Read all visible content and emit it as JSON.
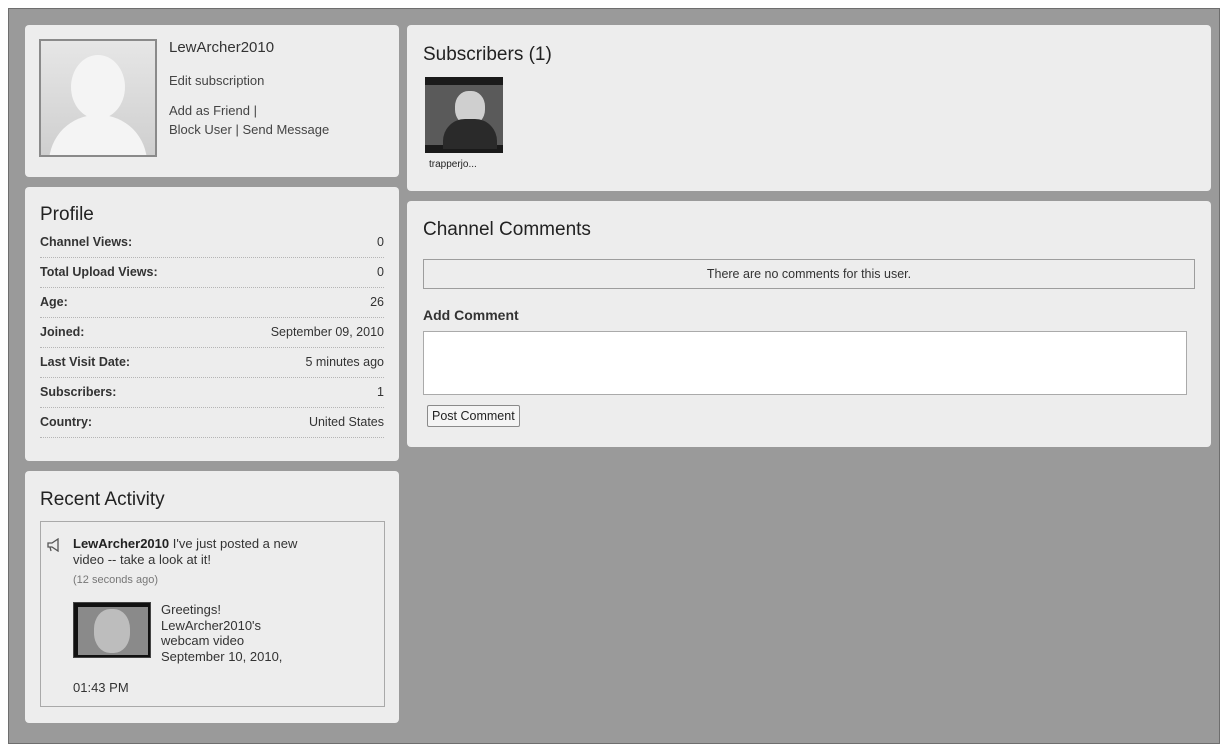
{
  "user": {
    "name": "LewArcher2010",
    "edit_subscription": "Edit subscription",
    "add_friend": "Add as Friend",
    "block_user": "Block User",
    "send_message": "Send Message",
    "separator": "|"
  },
  "profile": {
    "title": "Profile",
    "rows": [
      {
        "label": "Channel Views:",
        "value": "0"
      },
      {
        "label": "Total Upload Views:",
        "value": "0"
      },
      {
        "label": "Age:",
        "value": "26"
      },
      {
        "label": "Joined:",
        "value": "September 09, 2010"
      },
      {
        "label": "Last Visit Date:",
        "value": "5 minutes ago"
      },
      {
        "label": "Subscribers:",
        "value": "1"
      },
      {
        "label": "Country:",
        "value": "United States"
      }
    ]
  },
  "recent_activity": {
    "title": "Recent Activity",
    "user": "LewArcher2010",
    "message_line1": "I've just posted a new",
    "message_line2": "video -- take a look at it!",
    "time_ago": "(12 seconds ago)",
    "video_line1": "Greetings!",
    "video_line2": "LewArcher2010's",
    "video_line3": "webcam video",
    "video_line4": "September 10, 2010,",
    "video_line5": "01:43 PM"
  },
  "subscribers": {
    "title": "Subscribers (1)",
    "items": [
      {
        "name": "trapperjo..."
      }
    ]
  },
  "comments": {
    "title": "Channel Comments",
    "empty_text": "There are no comments for this user.",
    "add_label": "Add Comment",
    "post_button": "Post Comment"
  }
}
